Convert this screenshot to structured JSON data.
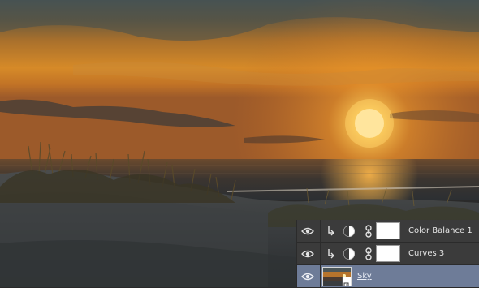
{
  "canvas": {
    "image": "sunset-beach-photo"
  },
  "layers_panel": {
    "layers": [
      {
        "name": "Color Balance 1",
        "visible_icon": "eye-icon",
        "clip_icon": "clip-arrow-icon",
        "adjustment_icon": "color-balance-icon",
        "link_icon": "chain-link-icon",
        "mask": "white"
      },
      {
        "name": "Curves 3",
        "visible_icon": "eye-icon",
        "clip_icon": "clip-arrow-icon",
        "adjustment_icon": "curves-icon",
        "link_icon": "chain-link-icon",
        "mask": "white"
      },
      {
        "name": "Sky",
        "visible_icon": "eye-icon",
        "thumbnail": "sky-thumbnail",
        "smart_object_badge": "smart-object-icon",
        "selected": true
      }
    ],
    "colors": {
      "panel_bg": "#3b3b3b",
      "selected_bg": "#6e7c98",
      "text": "#e6e6e6"
    }
  }
}
